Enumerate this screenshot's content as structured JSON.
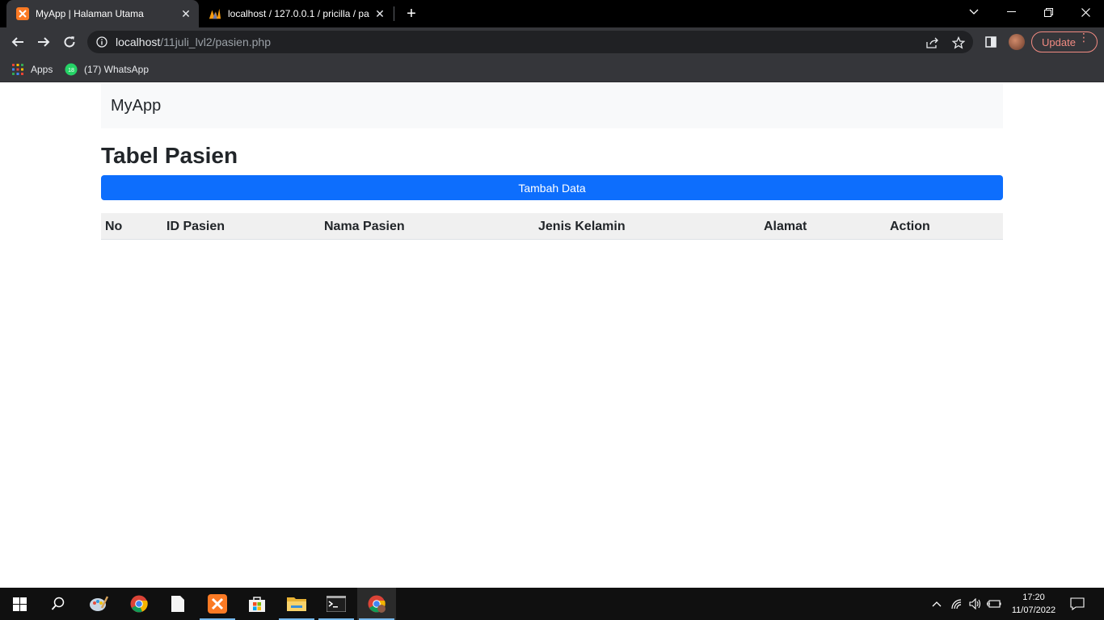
{
  "browser": {
    "tabs": [
      {
        "title": "MyApp | Halaman Utama",
        "active": true,
        "favicon": "xampp-icon"
      },
      {
        "title": "localhost / 127.0.0.1 / pricilla / pa",
        "active": false,
        "favicon": "phpmyadmin-icon"
      }
    ],
    "url_host": "localhost",
    "url_path": "/11juli_lvl2/pasien.php",
    "update_label": "Update",
    "bookmarks": [
      {
        "label": "Apps",
        "icon": "apps-grid-icon"
      },
      {
        "label": "(17) WhatsApp",
        "icon": "whatsapp-icon",
        "badge": "18"
      }
    ]
  },
  "page": {
    "brand": "MyApp",
    "title": "Tabel Pasien",
    "add_button": "Tambah Data",
    "table": {
      "headers": [
        "No",
        "ID Pasien",
        "Nama Pasien",
        "Jenis Kelamin",
        "Alamat",
        "Action"
      ],
      "rows": []
    }
  },
  "taskbar": {
    "apps": [
      "start-icon",
      "search-icon",
      "paint-icon",
      "chrome-icon",
      "file-icon",
      "xampp-icon",
      "store-icon",
      "explorer-icon",
      "cmd-icon",
      "chrome-icon"
    ],
    "time": "17:20",
    "date": "11/07/2022"
  },
  "colors": {
    "primary": "#0d6efd",
    "navbar_bg": "#f8f9fa",
    "table_head_bg": "#f0f0f0",
    "chrome_dark": "#35363a",
    "update_accent": "#f28b82"
  }
}
